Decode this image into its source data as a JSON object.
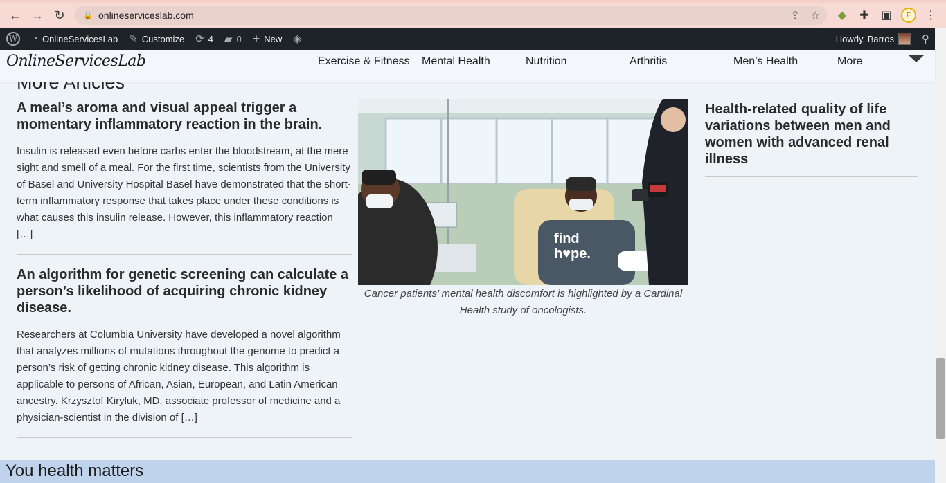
{
  "browser": {
    "url": "onlineserviceslab.com",
    "profile_letter": "F"
  },
  "admin_bar": {
    "site_name": "OnlineServicesLab",
    "customize": "Customize",
    "updates_count": "4",
    "comments_count": "0",
    "new_label": "New",
    "howdy": "Howdy, Barros"
  },
  "header": {
    "logo": "OnlineServicesLab",
    "menu": [
      {
        "label": "Exercise & Fitness"
      },
      {
        "label": "Mental Health"
      },
      {
        "label": "Nutrition"
      },
      {
        "label": "Arthritis"
      },
      {
        "label": "Men’s Health"
      },
      {
        "label": "More"
      }
    ]
  },
  "main": {
    "section_title": "More Articles",
    "articles": [
      {
        "title": "A meal’s aroma and visual appeal trigger a momentary inflammatory reaction in the brain.",
        "excerpt": "Insulin is released even before carbs enter the bloodstream, at the mere sight and smell of a meal. For the first time, scientists from the University of Basel and University Hospital Basel have demonstrated that the short-term inflammatory response that takes place under these conditions is what causes this insulin release. However, this inflammatory reaction […]"
      },
      {
        "title": "An algorithm for genetic screening can calculate a person’s likelihood of acquiring chronic kidney disease.",
        "excerpt": "Researchers at Columbia University have developed a novel algorithm that analyzes millions of mutations throughout the genome to predict a person’s risk of getting chronic kidney disease. This algorithm is applicable to persons of African, Asian, European, and Latin American ancestry. Krzysztof Kiryluk, MD, associate professor of medicine and a physician-scientist in the division of […]"
      }
    ],
    "featured": {
      "caption": "Cancer patients’ mental health discomfort is highlighted by a Cardinal Health study of oncologists.",
      "shirt_text_1": "find",
      "shirt_text_2": "h♥pe."
    },
    "side_article": {
      "title": "Health-related quality of life variations between men and women with advanced renal illness"
    },
    "footer_title": "You health matters"
  }
}
